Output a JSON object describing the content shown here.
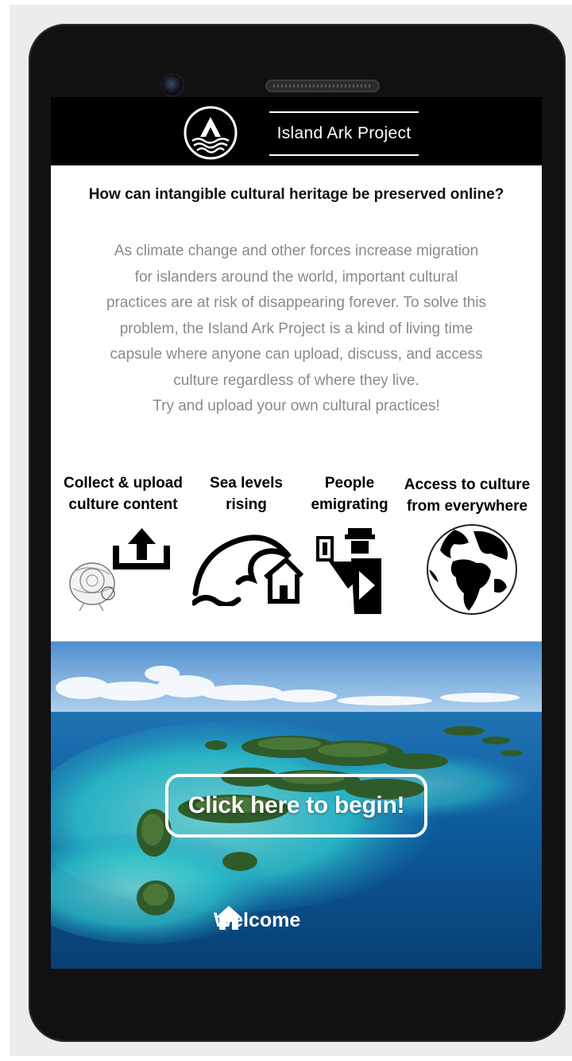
{
  "app": {
    "brand": "Island Ark Project",
    "logo_icon": "ark-wave-logo-icon"
  },
  "content": {
    "headline": "How can intangible cultural heritage be preserved online?",
    "intro_lines": [
      "As climate change and other forces increase migration",
      "for islanders around the world, important cultural",
      "practices are at risk of disappearing forever. To solve this",
      "problem, the Island Ark Project is a kind of living time",
      "capsule where anyone can upload, discuss, and access",
      "culture regardless of where they live.",
      "Try and upload your own cultural practices!"
    ]
  },
  "features": [
    {
      "lines": [
        "Collect & upload",
        "culture content"
      ],
      "icon": "upload-culture-icon"
    },
    {
      "lines": [
        "Sea levels",
        "rising"
      ],
      "icon": "sea-level-house-icon"
    },
    {
      "lines": [
        "People",
        "emigrating"
      ],
      "icon": "emigration-passport-icon"
    },
    {
      "lines": [
        "Access to culture",
        "from everywhere"
      ],
      "icon": "globe-icon"
    }
  ],
  "hero": {
    "cta_label": "Click here to begin!",
    "nav_label": "Welcome",
    "nav_icon": "home-icon"
  },
  "colors": {
    "topbar": "#000000",
    "intro_text": "#8a8a8a",
    "ocean_deep": "#0b4f8a",
    "lagoon": "#27b9c9"
  }
}
